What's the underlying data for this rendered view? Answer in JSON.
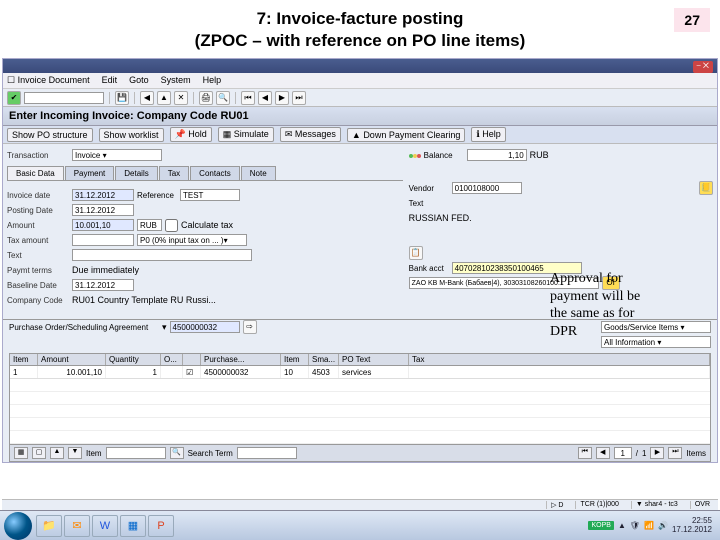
{
  "slide": {
    "title_line1": "7: Invoice-facture posting",
    "title_line2": "(ZPOC – with reference on PO line items)",
    "page_number": "27"
  },
  "sap": {
    "menu": [
      "Invoice Document",
      "Edit",
      "Goto",
      "System",
      "Help"
    ],
    "screen_title": "Enter Incoming Invoice: Company Code RU01",
    "toolbar_secondary": {
      "show_po": "Show PO structure",
      "worklist": "Show worklist",
      "hold": "Hold",
      "simulate": "Simulate",
      "messages": "Messages",
      "down_payment": "Down Payment Clearing",
      "help": "Help"
    },
    "header": {
      "transaction_label": "Transaction",
      "transaction_value": "Invoice",
      "balance_label": "Balance",
      "balance_value": "1,10",
      "balance_curr": "RUB"
    },
    "tabs": [
      "Basic Data",
      "Payment",
      "Details",
      "Tax",
      "Contacts",
      "Note"
    ],
    "details": {
      "invoice_date_label": "Invoice date",
      "invoice_date": "31.12.2012",
      "reference_label": "Reference",
      "reference": "TEST",
      "posting_date_label": "Posting Date",
      "posting_date": "31.12.2012",
      "amount_label": "Amount",
      "amount": "10.001,10",
      "currency": "RUB",
      "calc_tax_label": "Calculate tax",
      "tax_amount_label": "Tax amount",
      "tax_code": "P0 (0% input tax on ... )",
      "text_label": "Text",
      "paymt_terms_label": "Paymt terms",
      "paymt_terms": "Due immediately",
      "baseline_label": "Baseline Date",
      "baseline_date": "31.12.2012",
      "company_code_label": "Company Code",
      "company_code": "RU01 Country Template RU Russi..."
    },
    "vendor_panel": {
      "vendor_label": "Vendor",
      "vendor": "0100108000",
      "text_label": "Text",
      "country": "RUSSIAN FED.",
      "bank_acct_label": "Bank acct",
      "bank_acct": "40702810238350100465",
      "bank_name": "ZAO KB M-Bank (Бабаев|4), 30303108260100..."
    },
    "po_section": {
      "ref_label": "Purchase Order/Scheduling Agreement",
      "ref_value": "4500000032",
      "goods_label": "Goods/Service Items",
      "layout_label": "All Information"
    },
    "line_items": {
      "columns": {
        "item": "Item",
        "amount": "Amount",
        "quantity": "Quantity",
        "order": "O...",
        "chk": "",
        "purchase": "Purchase...",
        "item2": "Item",
        "sma": "Sma...",
        "potext": "PO Text",
        "tax": "Tax"
      },
      "rows": [
        {
          "item": "1",
          "amount": "10.001,10",
          "qty": "1",
          "order": "",
          "po": "4500000032",
          "po_item": "10",
          "sma": "4503",
          "text": "services"
        }
      ],
      "footer": {
        "pos_label": "Item",
        "search_label": "Search Term",
        "pager_current": "1",
        "pager_total": "1",
        "items_label": "Items"
      }
    },
    "statusbar": {
      "mode": "D",
      "system": "TCR (1)|000",
      "server": "shar4 - tc3",
      "ovr": "OVR"
    }
  },
  "annotation": "Approval for payment will be the same as for DPR",
  "taskbar": {
    "lang": "KOPB",
    "time": "22:55",
    "date": "17.12.2012"
  }
}
